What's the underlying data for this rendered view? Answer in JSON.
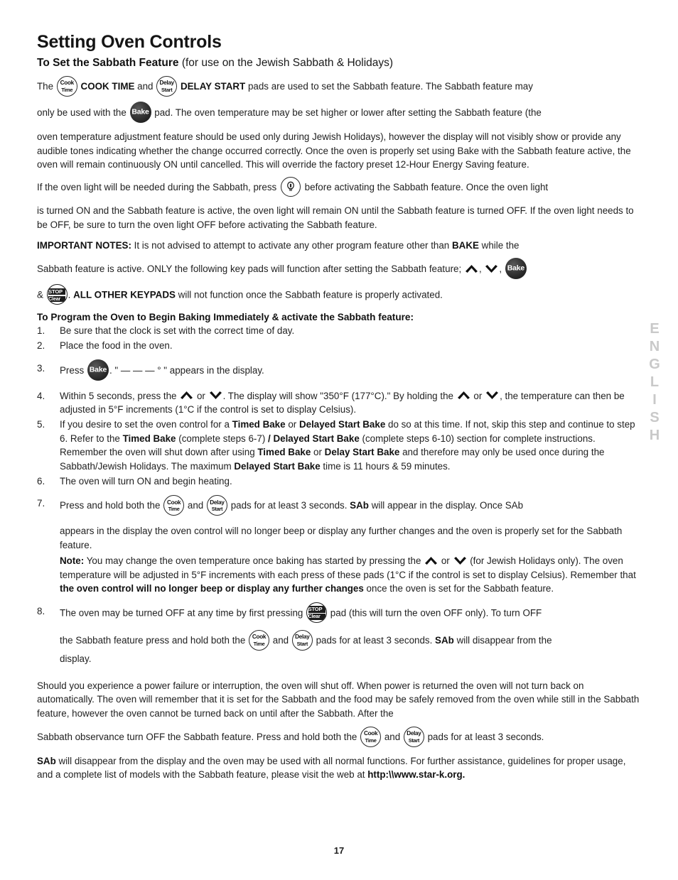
{
  "page": {
    "title": "Setting Oven Controls",
    "subtitle_bold": "To Set the Sabbath Feature",
    "subtitle_rest": " (for use on the Jewish Sabbath & Holidays)",
    "page_number": "17",
    "side_language": "ENGLISH",
    "side_language_color": "#c9c9c9"
  },
  "icons": {
    "cook_time": {
      "line1": "Cook",
      "line2": "Time",
      "name": "cook-time-pad-icon"
    },
    "delay_start": {
      "line1": "Delay",
      "line2": "Start",
      "name": "delay-start-pad-icon"
    },
    "bake": {
      "label": "Bake",
      "name": "bake-pad-icon"
    },
    "stop_clear": {
      "line1": "STOP",
      "line2": "Clear",
      "name": "stop-clear-pad-icon"
    },
    "oven_light": {
      "name": "oven-light-bulb-icon"
    },
    "arrow_up": {
      "name": "arrow-up-icon"
    },
    "arrow_down": {
      "name": "arrow-down-icon"
    }
  },
  "intro": {
    "p1_a": "The ",
    "p1_b": "COOK TIME",
    "p1_c": " and ",
    "p1_d": "DELAY START",
    "p1_e": " pads are used to set the Sabbath feature. The Sabbath feature may",
    "p2_a": "only be used with the ",
    "p2_b": " pad. The oven temperature may be set higher or lower after setting the Sabbath feature (the",
    "p3": "oven temperature adjustment feature should be used only during Jewish Holidays), however the display will not visibly show or provide any audible tones indicating whether the change occurred correctly. Once the oven is properly set using Bake with the Sabbath feature active, the oven will remain continuously ON until cancelled. This will override the factory preset 12-Hour Energy Saving feature.",
    "p4_a": "If the oven light will be needed during the Sabbath, press ",
    "p4_b": " before activating the Sabbath feature. Once the oven light",
    "p5": "is turned ON and the Sabbath feature is active, the oven light will remain ON until the Sabbath feature is turned OFF. If the oven light needs to be OFF, be sure to turn the oven light OFF before activating the Sabbath feature."
  },
  "important_notes": {
    "label": "IMPORTANT NOTES:",
    "line1_a": " It is not advised to attempt to activate any other program feature other than ",
    "line1_bold": "BAKE",
    "line1_b": " while the",
    "line2_a": "Sabbath feature is active. ONLY the following key pads will function after setting the Sabbath feature; ",
    "line2_sep1": ", ",
    "line2_sep2": ", ",
    "line3_a": "& ",
    "line3_b": ". ",
    "line3_bold": "ALL OTHER KEYPADS",
    "line3_c": " will not function once the Sabbath feature is properly activated."
  },
  "program_section": {
    "heading": "To Program the Oven to Begin Baking Immediately & activate the Sabbath feature:",
    "steps": [
      {
        "num": "1.",
        "text": "Be sure that the clock is set with the correct time of day."
      },
      {
        "num": "2.",
        "text": "Place the food in the oven."
      },
      {
        "num": "3.",
        "pre": "Press ",
        "post": ". \" — — — ° \" appears in the display."
      },
      {
        "num": "4.",
        "a": "Within 5 seconds, press the ",
        "b": " or ",
        "c": ". The display will show \"350°F (177°C).\" By holding the ",
        "d": " or ",
        "e": ", the temperature can then be adjusted in 5°F increments (1°C if the control is set to display Celsius)."
      },
      {
        "num": "5.",
        "t1": "If you desire to set the oven control for a ",
        "b1": "Timed Bake",
        "t2": " or ",
        "b2": "Delayed Start Bake",
        "t3": " do so at this time. If not, skip this step and continue to step 6. Refer to the ",
        "b3": "Timed Bake",
        "t4": " (complete steps 6-7)",
        "b4": " / Delayed Start Bake",
        "t5": " (complete steps 6-10) section for complete instructions. Remember the oven will shut down after using ",
        "b5": "Timed Bake",
        "t6": " or ",
        "b6": "Delay Start Bake",
        "t7": " and therefore may only be used once during the Sabbath/Jewish Holidays. The maximum ",
        "b7": "Delayed Start Bake",
        "t8": " time is 11 hours & 59 minutes."
      },
      {
        "num": "6.",
        "text": "The oven will turn ON and begin heating."
      },
      {
        "num": "7.",
        "a": "Press and hold both the ",
        "b": " and ",
        "c": " pads for at least 3 seconds. ",
        "sab": "SAb",
        "d": " will appear in the display. Once SAb",
        "para2": "appears in the display the oven control will no longer beep or display any further changes and the oven is properly set for the Sabbath feature.",
        "note_label": "Note:",
        "note_a": " You may change the oven temperature once baking has started by pressing the ",
        "note_b": " or ",
        "note_c": " (for Jewish Holidays only). The oven temperature will be adjusted in 5°F increments with each press of these pads (1°C if the control is set to display Celsius). Remember that ",
        "note_bold": "the oven control will no longer beep or display any further changes",
        "note_d": " once the oven is set for the Sabbath feature."
      },
      {
        "num": "8.",
        "a": "The oven may be turned OFF at any time by first pressing ",
        "b": " pad (this will turn the oven OFF only). To turn OFF",
        "c": "the Sabbath feature press and hold both the ",
        "d": " and ",
        "e": " pads for at least 3 seconds. ",
        "sab": "SAb",
        "f": " will disappear from the",
        "g": "display."
      }
    ]
  },
  "closing": {
    "p1": "Should you experience a power failure or interruption, the oven will shut off. When power is returned the oven will not turn back on automatically. The oven will remember that it is set for the Sabbath and the food may be safely removed from the oven while still in the Sabbath feature, however the oven cannot be turned back on until after the Sabbath. After the",
    "p2_a": "Sabbath observance turn OFF the Sabbath feature. Press and hold both the ",
    "p2_b": " and ",
    "p2_c": " pads for at least 3 seconds.",
    "p3_bold": "SAb",
    "p3_a": " will disappear from the display and the oven may be used with all normal functions. For further assistance, guidelines for proper usage, and a complete list of models with the Sabbath feature, please visit the web at ",
    "p3_url": "http:\\\\www.star-k.org."
  }
}
